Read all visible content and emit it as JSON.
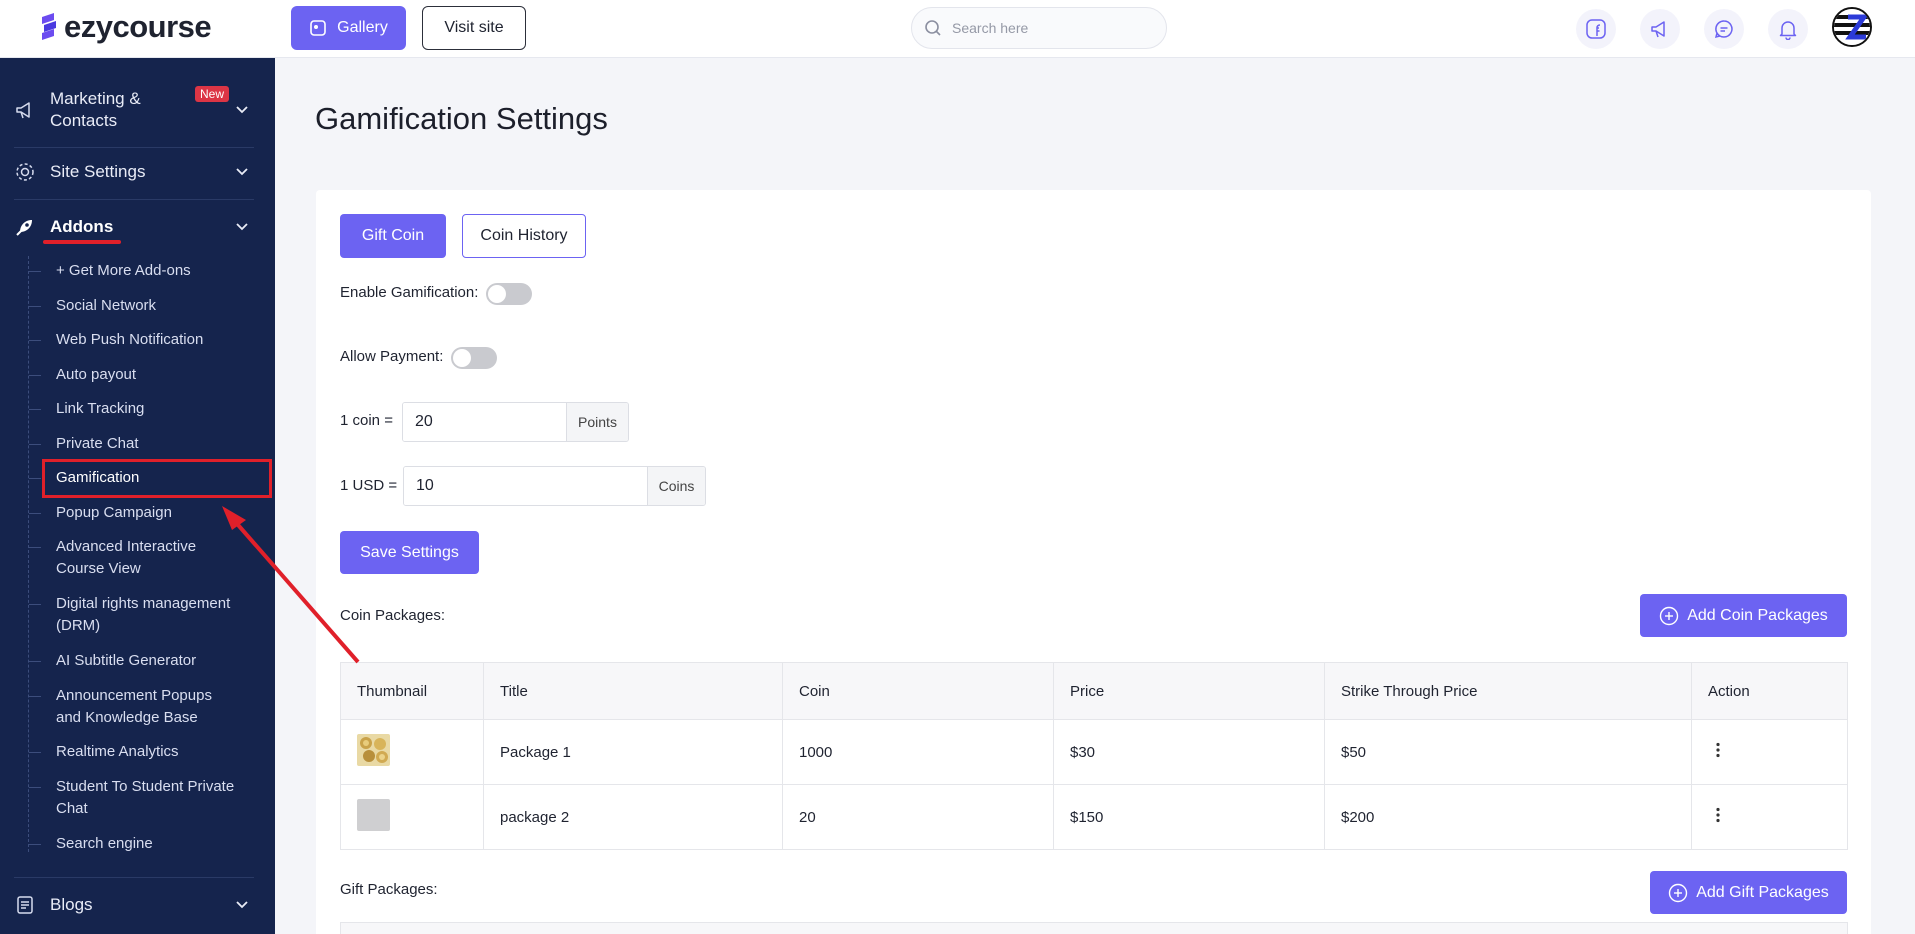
{
  "brand": {
    "name": "ezycourse"
  },
  "topbar": {
    "gallery_label": "Gallery",
    "visit_label": "Visit site",
    "search_placeholder": "Search here",
    "icons": [
      "facebook-icon",
      "megaphone-icon",
      "chat-icon",
      "bell-icon"
    ],
    "accent": "#6c63f2"
  },
  "sidebar": {
    "bg": "#15244d",
    "main": [
      {
        "label": "Marketing & Contacts",
        "badge": "New"
      },
      {
        "label": "Site Settings"
      },
      {
        "label": "Addons"
      },
      {
        "label": "Blogs"
      }
    ],
    "subitems": [
      "+ Get More Add-ons",
      "Social Network",
      "Web Push Notification",
      "Auto payout",
      "Link Tracking",
      "Private Chat",
      "Gamification",
      "Popup Campaign",
      "Advanced Interactive Course View",
      "Digital rights management (DRM)",
      "AI Subtitle Generator",
      "Announcement Popups and Knowledge Base",
      "Realtime Analytics",
      "Student To Student Private Chat",
      "Search engine"
    ],
    "active_subitem": "Gamification"
  },
  "page": {
    "title": "Gamification Settings"
  },
  "tabs": {
    "gift": "Gift Coin",
    "history": "Coin History"
  },
  "form": {
    "enable_label": "Enable Gamification:",
    "enable_on": false,
    "payment_label": "Allow Payment:",
    "payment_on": false,
    "coin_label": "1 coin =",
    "coin_value": "20",
    "coin_unit": "Points",
    "usd_label": "1 USD =",
    "usd_value": "10",
    "usd_unit": "Coins",
    "save_label": "Save Settings"
  },
  "coin_packages": {
    "label": "Coin Packages:",
    "add_label": "Add Coin Packages",
    "columns": [
      "Thumbnail",
      "Title",
      "Coin",
      "Price",
      "Strike Through Price",
      "Action"
    ],
    "rows": [
      {
        "title": "Package 1",
        "coin": "1000",
        "price": "$30",
        "strike": "$50"
      },
      {
        "title": "package 2",
        "coin": "20",
        "price": "$150",
        "strike": "$200"
      }
    ]
  },
  "gift_packages": {
    "label": "Gift Packages:",
    "add_label": "Add Gift Packages"
  }
}
